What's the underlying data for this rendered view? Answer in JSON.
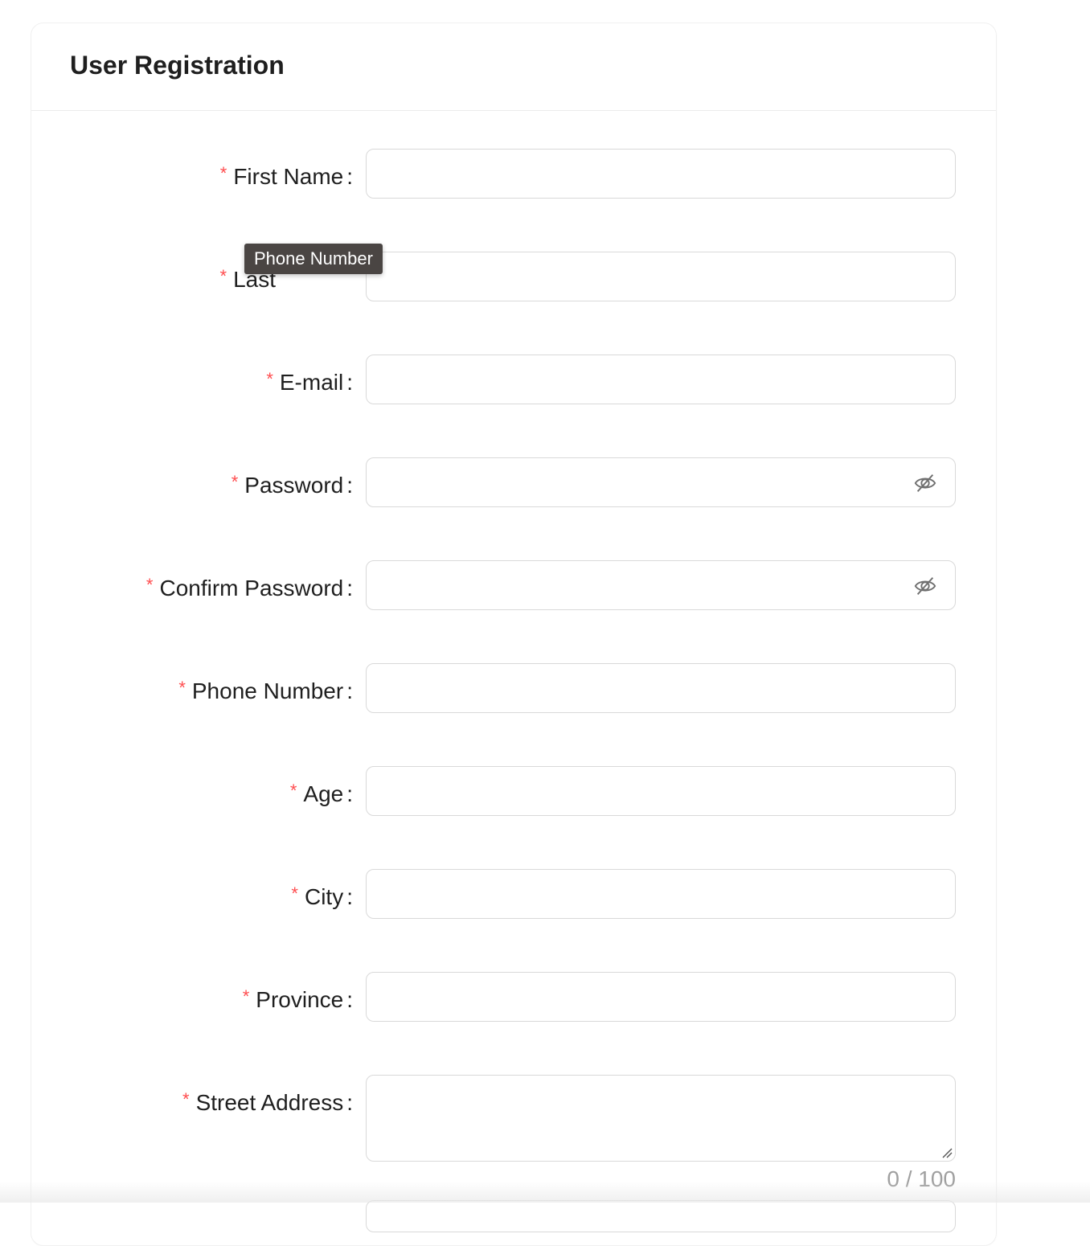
{
  "form": {
    "title": "User Registration",
    "required_mark": "*",
    "colon": ":",
    "fields": {
      "first_name": {
        "label": "First Name",
        "value": ""
      },
      "last_name": {
        "label": "Last",
        "value": ""
      },
      "email": {
        "label": "E-mail",
        "value": ""
      },
      "password": {
        "label": "Password",
        "value": ""
      },
      "confirm_password": {
        "label": "Confirm Password",
        "value": ""
      },
      "phone": {
        "label": "Phone Number",
        "value": ""
      },
      "age": {
        "label": "Age",
        "value": ""
      },
      "city": {
        "label": "City",
        "value": ""
      },
      "province": {
        "label": "Province",
        "value": ""
      },
      "street_address": {
        "label": "Street Address",
        "value": "",
        "counter": "0 / 100"
      }
    }
  },
  "tooltip": {
    "text": "Phone Number"
  },
  "icons": {
    "password_toggle": "eye-invisible-icon",
    "resize": "resize-handle-icon"
  },
  "colors": {
    "required": "#ff4d4f",
    "border": "#d9d9d9",
    "tooltip_bg": "#4a4543"
  }
}
